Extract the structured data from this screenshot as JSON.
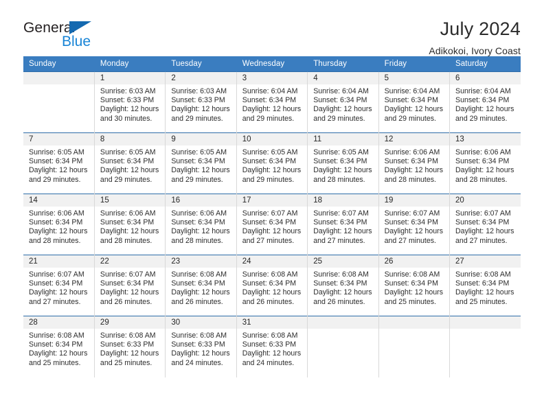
{
  "brand": {
    "name_part1": "General",
    "name_part2": "Blue",
    "accent_color": "#1884d6",
    "triangle_color": "#1469b0"
  },
  "header": {
    "title": "July 2024",
    "subtitle": "Adikokoi, Ivory Coast"
  },
  "calendar": {
    "header_bg": "#3a7dc0",
    "row_line_color": "#2e6da8",
    "daynum_bg": "#f1f1f1",
    "weekdays": [
      "Sunday",
      "Monday",
      "Tuesday",
      "Wednesday",
      "Thursday",
      "Friday",
      "Saturday"
    ],
    "weeks": [
      [
        {
          "day": "",
          "lines": []
        },
        {
          "day": "1",
          "lines": [
            "Sunrise: 6:03 AM",
            "Sunset: 6:33 PM",
            "Daylight: 12 hours",
            "and 30 minutes."
          ]
        },
        {
          "day": "2",
          "lines": [
            "Sunrise: 6:03 AM",
            "Sunset: 6:33 PM",
            "Daylight: 12 hours",
            "and 29 minutes."
          ]
        },
        {
          "day": "3",
          "lines": [
            "Sunrise: 6:04 AM",
            "Sunset: 6:34 PM",
            "Daylight: 12 hours",
            "and 29 minutes."
          ]
        },
        {
          "day": "4",
          "lines": [
            "Sunrise: 6:04 AM",
            "Sunset: 6:34 PM",
            "Daylight: 12 hours",
            "and 29 minutes."
          ]
        },
        {
          "day": "5",
          "lines": [
            "Sunrise: 6:04 AM",
            "Sunset: 6:34 PM",
            "Daylight: 12 hours",
            "and 29 minutes."
          ]
        },
        {
          "day": "6",
          "lines": [
            "Sunrise: 6:04 AM",
            "Sunset: 6:34 PM",
            "Daylight: 12 hours",
            "and 29 minutes."
          ]
        }
      ],
      [
        {
          "day": "7",
          "lines": [
            "Sunrise: 6:05 AM",
            "Sunset: 6:34 PM",
            "Daylight: 12 hours",
            "and 29 minutes."
          ]
        },
        {
          "day": "8",
          "lines": [
            "Sunrise: 6:05 AM",
            "Sunset: 6:34 PM",
            "Daylight: 12 hours",
            "and 29 minutes."
          ]
        },
        {
          "day": "9",
          "lines": [
            "Sunrise: 6:05 AM",
            "Sunset: 6:34 PM",
            "Daylight: 12 hours",
            "and 29 minutes."
          ]
        },
        {
          "day": "10",
          "lines": [
            "Sunrise: 6:05 AM",
            "Sunset: 6:34 PM",
            "Daylight: 12 hours",
            "and 29 minutes."
          ]
        },
        {
          "day": "11",
          "lines": [
            "Sunrise: 6:05 AM",
            "Sunset: 6:34 PM",
            "Daylight: 12 hours",
            "and 28 minutes."
          ]
        },
        {
          "day": "12",
          "lines": [
            "Sunrise: 6:06 AM",
            "Sunset: 6:34 PM",
            "Daylight: 12 hours",
            "and 28 minutes."
          ]
        },
        {
          "day": "13",
          "lines": [
            "Sunrise: 6:06 AM",
            "Sunset: 6:34 PM",
            "Daylight: 12 hours",
            "and 28 minutes."
          ]
        }
      ],
      [
        {
          "day": "14",
          "lines": [
            "Sunrise: 6:06 AM",
            "Sunset: 6:34 PM",
            "Daylight: 12 hours",
            "and 28 minutes."
          ]
        },
        {
          "day": "15",
          "lines": [
            "Sunrise: 6:06 AM",
            "Sunset: 6:34 PM",
            "Daylight: 12 hours",
            "and 28 minutes."
          ]
        },
        {
          "day": "16",
          "lines": [
            "Sunrise: 6:06 AM",
            "Sunset: 6:34 PM",
            "Daylight: 12 hours",
            "and 28 minutes."
          ]
        },
        {
          "day": "17",
          "lines": [
            "Sunrise: 6:07 AM",
            "Sunset: 6:34 PM",
            "Daylight: 12 hours",
            "and 27 minutes."
          ]
        },
        {
          "day": "18",
          "lines": [
            "Sunrise: 6:07 AM",
            "Sunset: 6:34 PM",
            "Daylight: 12 hours",
            "and 27 minutes."
          ]
        },
        {
          "day": "19",
          "lines": [
            "Sunrise: 6:07 AM",
            "Sunset: 6:34 PM",
            "Daylight: 12 hours",
            "and 27 minutes."
          ]
        },
        {
          "day": "20",
          "lines": [
            "Sunrise: 6:07 AM",
            "Sunset: 6:34 PM",
            "Daylight: 12 hours",
            "and 27 minutes."
          ]
        }
      ],
      [
        {
          "day": "21",
          "lines": [
            "Sunrise: 6:07 AM",
            "Sunset: 6:34 PM",
            "Daylight: 12 hours",
            "and 27 minutes."
          ]
        },
        {
          "day": "22",
          "lines": [
            "Sunrise: 6:07 AM",
            "Sunset: 6:34 PM",
            "Daylight: 12 hours",
            "and 26 minutes."
          ]
        },
        {
          "day": "23",
          "lines": [
            "Sunrise: 6:08 AM",
            "Sunset: 6:34 PM",
            "Daylight: 12 hours",
            "and 26 minutes."
          ]
        },
        {
          "day": "24",
          "lines": [
            "Sunrise: 6:08 AM",
            "Sunset: 6:34 PM",
            "Daylight: 12 hours",
            "and 26 minutes."
          ]
        },
        {
          "day": "25",
          "lines": [
            "Sunrise: 6:08 AM",
            "Sunset: 6:34 PM",
            "Daylight: 12 hours",
            "and 26 minutes."
          ]
        },
        {
          "day": "26",
          "lines": [
            "Sunrise: 6:08 AM",
            "Sunset: 6:34 PM",
            "Daylight: 12 hours",
            "and 25 minutes."
          ]
        },
        {
          "day": "27",
          "lines": [
            "Sunrise: 6:08 AM",
            "Sunset: 6:34 PM",
            "Daylight: 12 hours",
            "and 25 minutes."
          ]
        }
      ],
      [
        {
          "day": "28",
          "lines": [
            "Sunrise: 6:08 AM",
            "Sunset: 6:34 PM",
            "Daylight: 12 hours",
            "and 25 minutes."
          ]
        },
        {
          "day": "29",
          "lines": [
            "Sunrise: 6:08 AM",
            "Sunset: 6:33 PM",
            "Daylight: 12 hours",
            "and 25 minutes."
          ]
        },
        {
          "day": "30",
          "lines": [
            "Sunrise: 6:08 AM",
            "Sunset: 6:33 PM",
            "Daylight: 12 hours",
            "and 24 minutes."
          ]
        },
        {
          "day": "31",
          "lines": [
            "Sunrise: 6:08 AM",
            "Sunset: 6:33 PM",
            "Daylight: 12 hours",
            "and 24 minutes."
          ]
        },
        {
          "day": "",
          "lines": []
        },
        {
          "day": "",
          "lines": []
        },
        {
          "day": "",
          "lines": []
        }
      ]
    ]
  }
}
